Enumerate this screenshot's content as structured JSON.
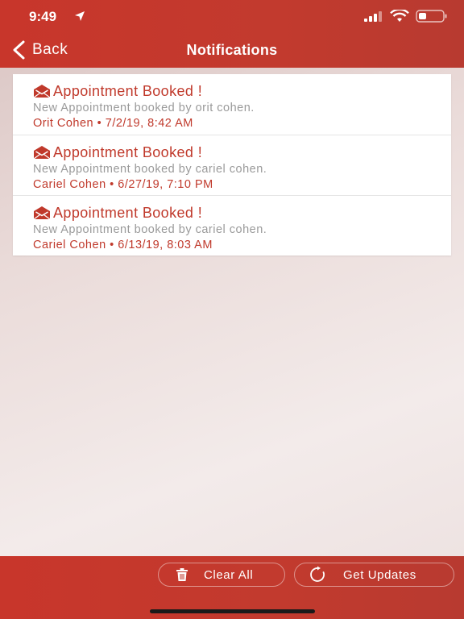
{
  "status_bar": {
    "time": "9:49"
  },
  "nav": {
    "back_label": "Back",
    "title": "Notifications"
  },
  "notifications": [
    {
      "title": "Appointment Booked !",
      "body": "New Appointment booked by orit cohen.",
      "author": "Orit Cohen",
      "separator": "•",
      "timestamp": "7/2/19, 8:42 AM"
    },
    {
      "title": "Appointment Booked !",
      "body": "New Appointment booked by cariel cohen.",
      "author": "Cariel Cohen",
      "separator": "•",
      "timestamp": "6/27/19, 7:10 PM"
    },
    {
      "title": "Appointment Booked !",
      "body": "New Appointment booked by cariel cohen.",
      "author": "Cariel Cohen",
      "separator": "•",
      "timestamp": "6/13/19, 8:03 AM"
    }
  ],
  "footer": {
    "clear_all_label": "Clear All",
    "get_updates_label": "Get Updates"
  },
  "icons": {
    "envelope": "envelope-icon",
    "trash": "trash-icon",
    "refresh": "refresh-icon",
    "back": "chevron-left-icon"
  },
  "colors": {
    "brand": "#c8362b",
    "title_text": "#c0392b",
    "body_text": "#9a9a9a"
  }
}
